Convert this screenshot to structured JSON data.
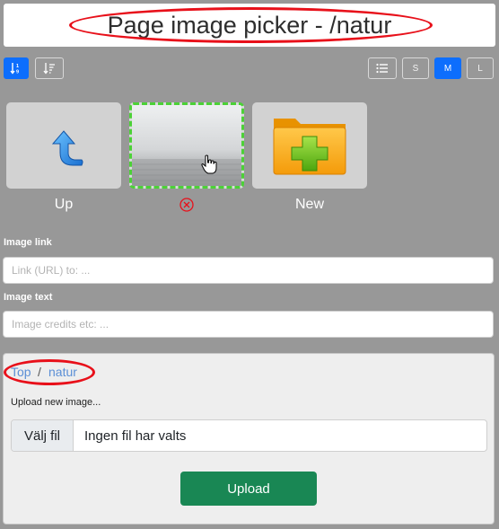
{
  "header": {
    "title": "Page image picker - /natur"
  },
  "toolbar": {
    "sort_asc_icon": "sort-numeric-down-icon",
    "sort_desc_icon": "sort-amount-down-icon",
    "list_view_icon": "list-icon",
    "size_buttons": [
      "S",
      "M",
      "L"
    ],
    "active_size": "M"
  },
  "tiles": [
    {
      "label": "Up",
      "icon": "folder-up-arrow-icon"
    },
    {
      "label": "",
      "icon": "image-thumbnail",
      "selected": true,
      "remove_icon": "remove-circle-icon"
    },
    {
      "label": "New",
      "icon": "new-folder-icon"
    }
  ],
  "form": {
    "image_link_label": "Image link",
    "image_link_placeholder": "Link (URL) to: ...",
    "image_text_label": "Image text",
    "image_text_placeholder": "Image credits etc: ..."
  },
  "breadcrumb": {
    "items": [
      "Top",
      "natur"
    ],
    "separator": "/"
  },
  "upload": {
    "label": "Upload new image...",
    "choose_file": "Välj fil",
    "no_file": "Ingen fil har valts",
    "button": "Upload"
  },
  "colors": {
    "primary": "#0d6efd",
    "success": "#198754",
    "annotation": "#e8101a",
    "selection": "#4cd137",
    "link": "#5b8fd6"
  }
}
